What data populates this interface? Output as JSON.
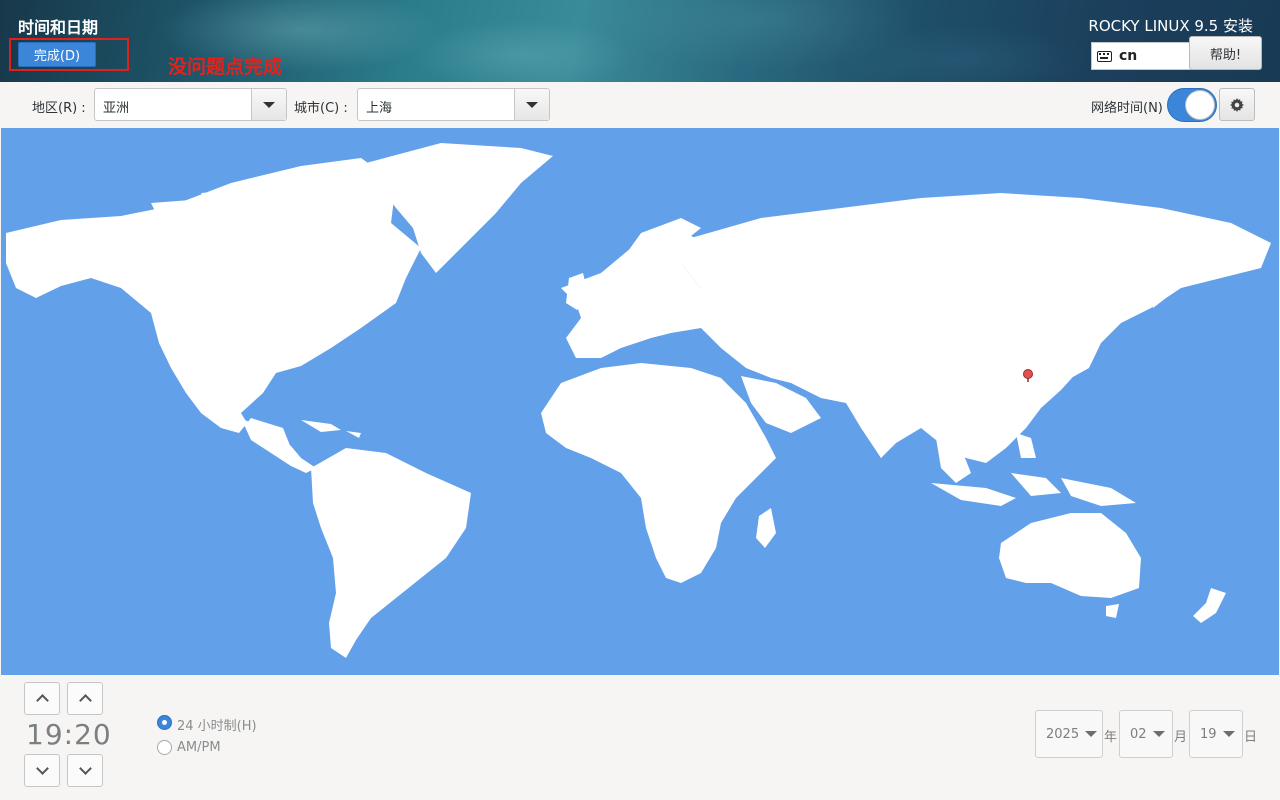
{
  "header": {
    "page_title": "时间和日期",
    "done_label": "完成(D)",
    "annotation": "没问题点完成",
    "product_title": "ROCKY LINUX 9.5 安装",
    "keyboard_layout": "cn",
    "keyboard_icon": "keyboard-icon",
    "help_label": "帮助!"
  },
  "toolbar": {
    "region_label": "地区(R) :",
    "region_value": "亚洲",
    "city_label": "城市(C) :",
    "city_value": "上海",
    "network_time_label": "网络时间(N)",
    "network_time_on": true,
    "settings_icon": "gear-icon"
  },
  "map": {
    "selected_city": "上海",
    "pin_color": "#e05252",
    "ocean_color": "#62a0ea",
    "land_color": "#ffffff"
  },
  "time": {
    "hours": "19",
    "separator": ":",
    "minutes": "20",
    "format_24h_label": "24 小时制(H)",
    "format_ampm_label": "AM/PM",
    "selected_format": "24h"
  },
  "date": {
    "year": "2025",
    "year_unit": "年",
    "month": "02",
    "month_unit": "月",
    "day": "19",
    "day_unit": "日"
  },
  "colors": {
    "accent": "#3b86d8",
    "annotation_red": "#e0201c"
  }
}
